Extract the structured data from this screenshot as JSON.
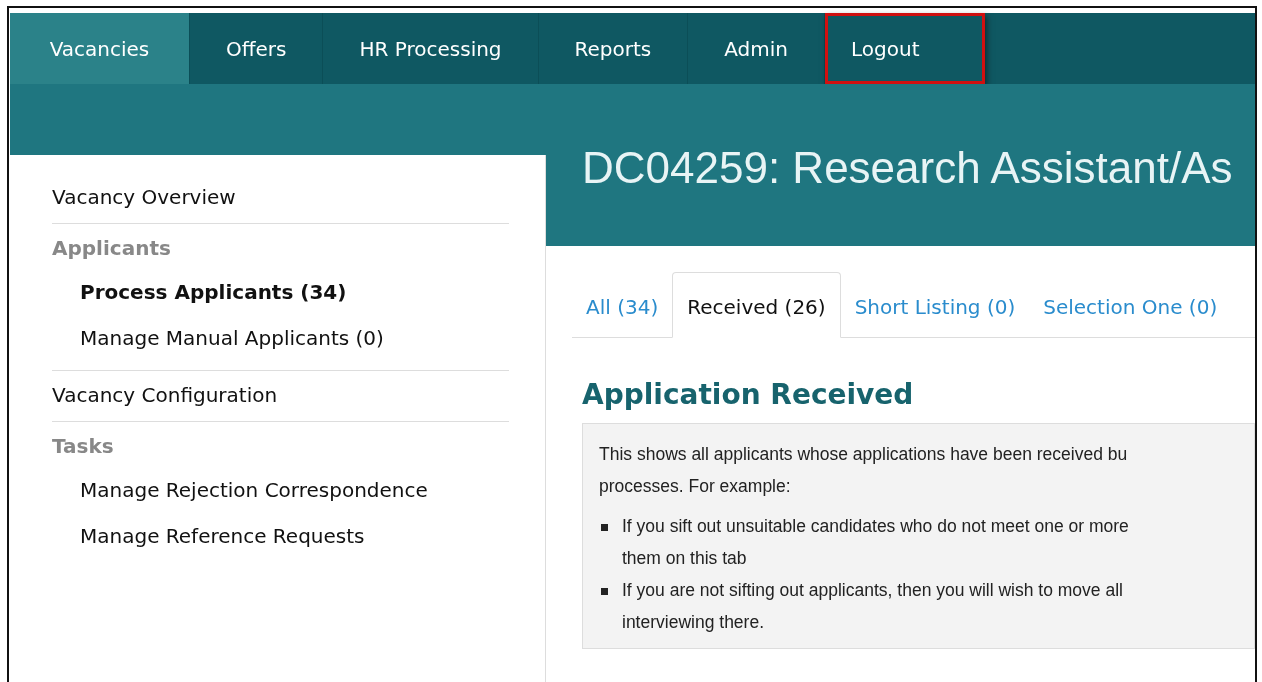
{
  "nav": [
    {
      "label": "Vacancies",
      "selected": true,
      "highlighted": false
    },
    {
      "label": "Offers",
      "selected": false,
      "highlighted": false
    },
    {
      "label": "HR Processing",
      "selected": false,
      "highlighted": false
    },
    {
      "label": "Reports",
      "selected": false,
      "highlighted": false
    },
    {
      "label": "Admin",
      "selected": false,
      "highlighted": false
    },
    {
      "label": "Logout",
      "selected": false,
      "highlighted": true
    }
  ],
  "page_title": "DC04259: Research Assistant/As",
  "sidebar": [
    {
      "kind": "link",
      "label": "Vacancy Overview"
    },
    {
      "kind": "heading",
      "label": "Applicants",
      "children": [
        {
          "label": "Process Applicants (34)",
          "selected": true
        },
        {
          "label": "Manage Manual Applicants (0)",
          "selected": false
        }
      ]
    },
    {
      "kind": "link",
      "label": "Vacancy Configuration"
    },
    {
      "kind": "heading",
      "label": "Tasks",
      "children": [
        {
          "label": "Manage Rejection Correspondence",
          "selected": false
        },
        {
          "label": "Manage Reference Requests",
          "selected": false
        }
      ]
    }
  ],
  "tabs": [
    {
      "label": "All (34)",
      "selected": false
    },
    {
      "label": "Received (26)",
      "selected": true
    },
    {
      "label": "Short Listing (0)",
      "selected": false
    },
    {
      "label": "Selection One (0)",
      "selected": false
    }
  ],
  "section_title": "Application Received",
  "info": {
    "lines": [
      "This shows all applicants whose applications have been received bu",
      "processes. For example:"
    ],
    "bullets": [
      [
        "If you sift out unsuitable candidates who do not meet one or more",
        "them on this tab"
      ],
      [
        "If you are not sifting out applicants, then you will wish to move all",
        "interviewing there."
      ]
    ]
  }
}
